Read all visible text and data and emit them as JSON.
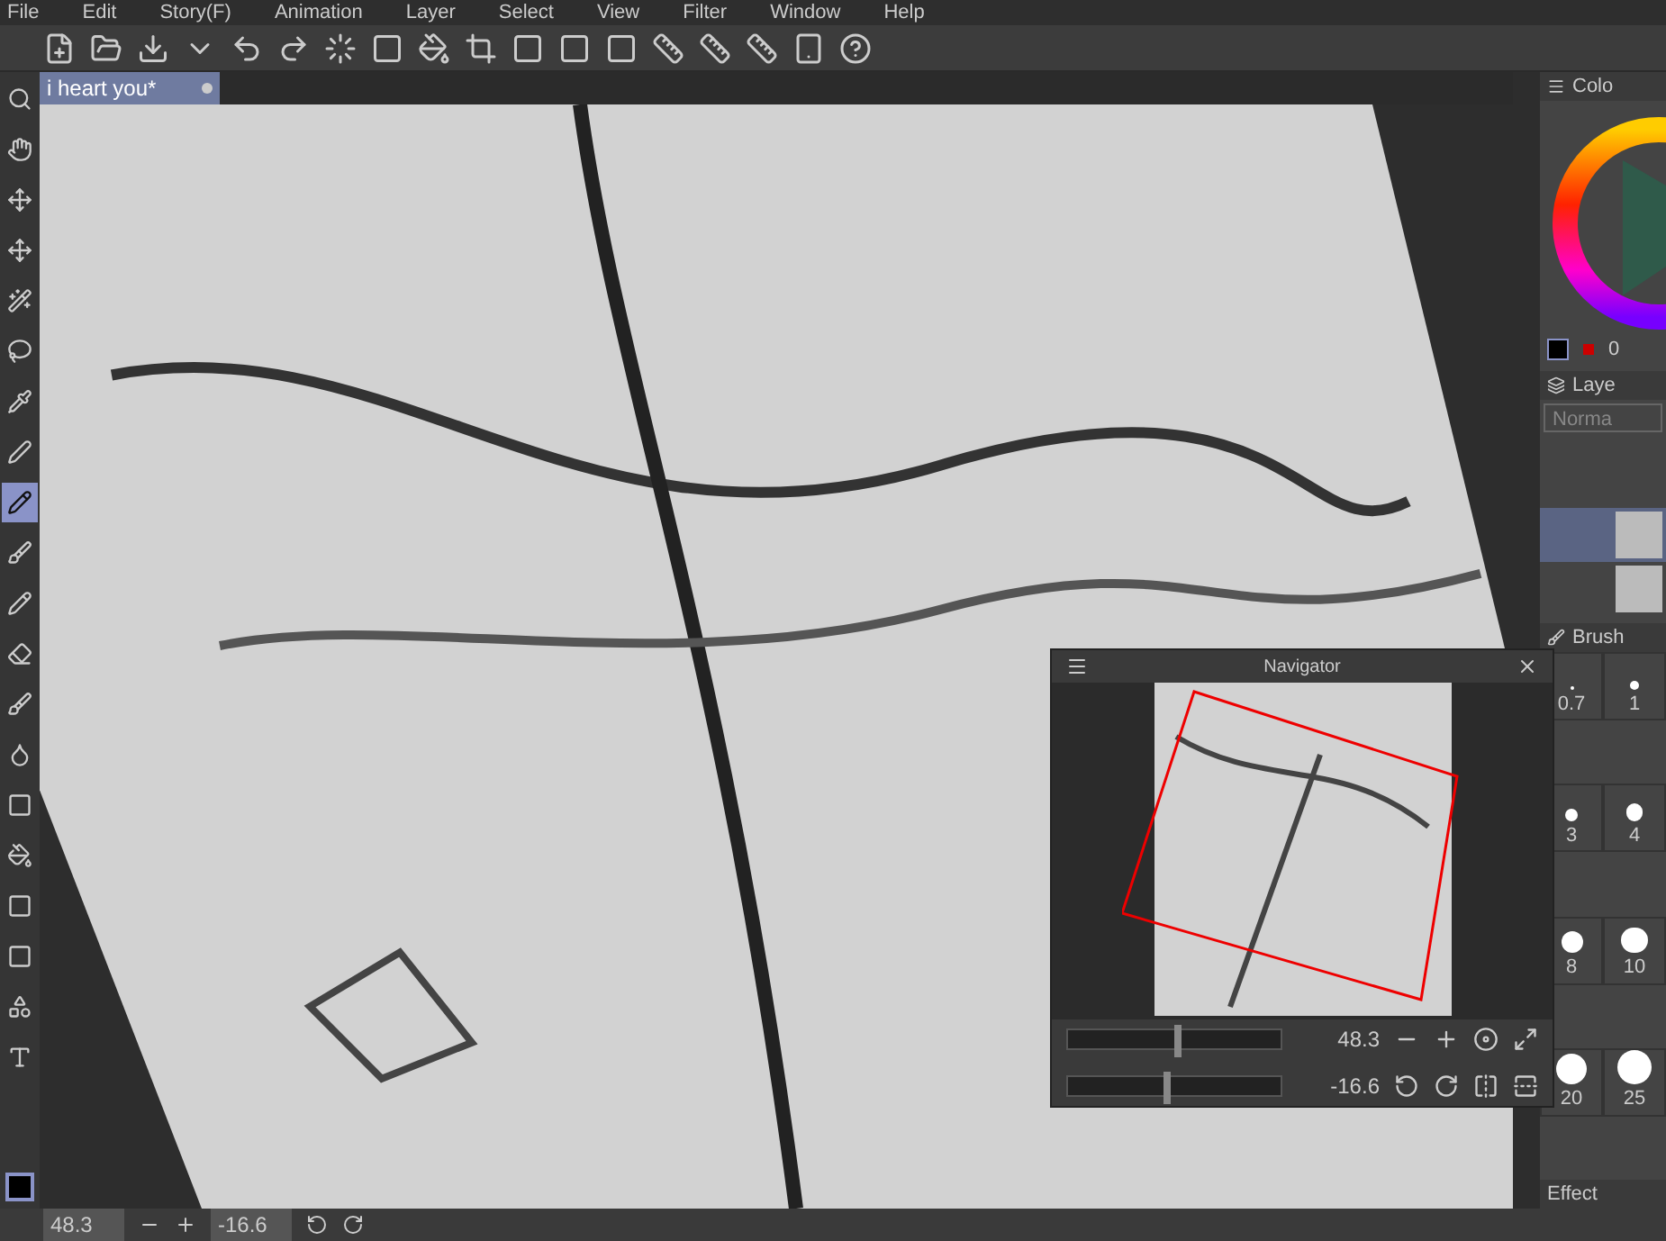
{
  "menu": [
    "File",
    "Edit",
    "Story(F)",
    "Animation",
    "Layer",
    "Select",
    "View",
    "Filter",
    "Window",
    "Help"
  ],
  "document_tab": {
    "title": "i heart you*"
  },
  "tools": [
    {
      "selected": false
    },
    {
      "selected": false
    },
    {
      "selected": false
    },
    {
      "selected": false
    },
    {
      "selected": false
    },
    {
      "selected": false
    },
    {
      "selected": false
    },
    {
      "selected": false
    },
    {
      "selected": true
    },
    {
      "selected": false
    },
    {
      "selected": false
    },
    {
      "selected": false
    },
    {
      "selected": false
    },
    {
      "selected": false
    },
    {
      "selected": false
    },
    {
      "selected": false
    },
    {
      "selected": false
    },
    {
      "selected": false
    },
    {
      "selected": false
    },
    {
      "selected": false
    }
  ],
  "color_panel": {
    "title": "Colo",
    "value": "0"
  },
  "layer_panel": {
    "title": "Laye",
    "blend_mode": "Norma",
    "layers": [
      {
        "selected": true
      },
      {
        "selected": false
      }
    ]
  },
  "brush_panel": {
    "title": "Brush",
    "sizes": [
      "0.7",
      "1",
      "3",
      "4",
      "8",
      "10",
      "20",
      "25"
    ]
  },
  "effect_panel": {
    "title": "Effect"
  },
  "navigator": {
    "title": "Navigator",
    "zoom": {
      "value": "48.3",
      "level": 0.5
    },
    "rotation": {
      "value": "-16.6",
      "level": 0.45
    }
  },
  "status_bar": {
    "zoom": "48.3",
    "rotation": "-16.6"
  }
}
